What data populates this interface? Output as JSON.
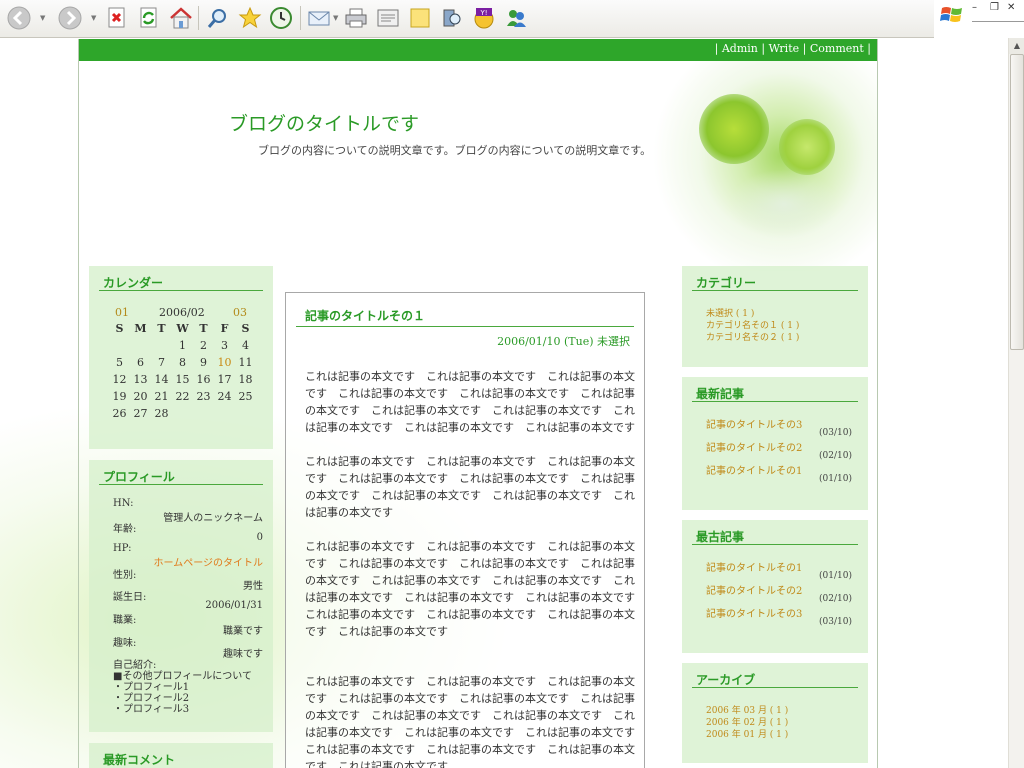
{
  "browser": {
    "toolbar_icons": [
      "back-icon",
      "forward-icon",
      "stop-icon",
      "refresh-icon",
      "home-icon",
      "search-icon",
      "favorites-icon",
      "history-icon",
      "mail-icon",
      "print-icon",
      "edit-icon",
      "discuss-icon",
      "research-icon",
      "messenger-yahoo-icon",
      "messenger-icon"
    ]
  },
  "window": {
    "minimize_glyph": "–",
    "restore_glyph": "❐",
    "close_glyph": "✕"
  },
  "topbar": {
    "sep": "|",
    "links": [
      "Admin",
      "Write",
      "Comment"
    ]
  },
  "header": {
    "title": "ブログのタイトルです",
    "description": "ブログの内容についての説明文章です。ブログの内容についての説明文章です。"
  },
  "calendar": {
    "title": "カレンダー",
    "prev": "01",
    "month": "2006/02",
    "next": "03",
    "weekdays": [
      "S",
      "M",
      "T",
      "W",
      "T",
      "F",
      "S"
    ],
    "weeks": [
      [
        "",
        "",
        "",
        "1",
        "2",
        "3",
        "4"
      ],
      [
        "5",
        "6",
        "7",
        "8",
        "9",
        "10",
        "11"
      ],
      [
        "12",
        "13",
        "14",
        "15",
        "16",
        "17",
        "18"
      ],
      [
        "19",
        "20",
        "21",
        "22",
        "23",
        "24",
        "25"
      ],
      [
        "26",
        "27",
        "28",
        "",
        "",
        "",
        ""
      ]
    ],
    "highlight": "10"
  },
  "profile": {
    "title": "プロフィール",
    "rows": [
      {
        "label": "HN:",
        "value": ""
      },
      {
        "label": "",
        "value": "管理人のニックネーム"
      },
      {
        "label": "年齢:",
        "value": ""
      },
      {
        "label": "",
        "value": "0"
      },
      {
        "label": "HP:",
        "value": ""
      },
      {
        "label": "",
        "value": "ホームページのタイトル"
      },
      {
        "label": "性別:",
        "value": ""
      },
      {
        "label": "",
        "value": "男性"
      },
      {
        "label": "誕生日:",
        "value": ""
      },
      {
        "label": "",
        "value": "2006/01/31"
      },
      {
        "label": "職業:",
        "value": ""
      },
      {
        "label": "",
        "value": "職業です"
      },
      {
        "label": "趣味:",
        "value": ""
      },
      {
        "label": "",
        "value": "趣味です"
      }
    ],
    "intro_label": "自己紹介:",
    "intro_lines": [
      "■その他プロフィールについて",
      "・プロフィール1",
      "・プロフィール2",
      "・プロフィール3"
    ]
  },
  "recent_comments": {
    "title": "最新コメント"
  },
  "categories": {
    "title": "カテゴリー",
    "items": [
      "未選択 ( 1 )",
      "カテゴリ名その１ ( 1 )",
      "カテゴリ名その２ ( 1 )"
    ]
  },
  "latest_entries": {
    "title": "最新記事",
    "items": [
      {
        "title": "記事のタイトルその3",
        "date": "(03/10)"
      },
      {
        "title": "記事のタイトルその2",
        "date": "(02/10)"
      },
      {
        "title": "記事のタイトルその1",
        "date": "(01/10)"
      }
    ]
  },
  "oldest_entries": {
    "title": "最古記事",
    "items": [
      {
        "title": "記事のタイトルその1",
        "date": "(01/10)"
      },
      {
        "title": "記事のタイトルその2",
        "date": "(02/10)"
      },
      {
        "title": "記事のタイトルその3",
        "date": "(03/10)"
      }
    ]
  },
  "archive": {
    "title": "アーカイブ",
    "items": [
      "2006 年 03 月 ( 1 )",
      "2006 年 02 月 ( 1 )",
      "2006 年 01 月 ( 1 )"
    ]
  },
  "article": {
    "title": "記事のタイトルその１",
    "date": "2006/01/10 (Tue)",
    "category": "未選択",
    "paragraphs": [
      [
        "これは記事の本文です　これは記事の本文です　これは記事の本文",
        "です　これは記事の本文です　これは記事の本文です　これは記事",
        "の本文です　これは記事の本文です　これは記事の本文です　これ",
        "は記事の本文です　これは記事の本文です　これは記事の本文です"
      ],
      [
        "これは記事の本文です　これは記事の本文です　これは記事の本文",
        "です　これは記事の本文です　これは記事の本文です　これは記事",
        "の本文です　これは記事の本文です　これは記事の本文です　これ",
        "は記事の本文です"
      ],
      [
        "これは記事の本文です　これは記事の本文です　これは記事の本文",
        "です　これは記事の本文です　これは記事の本文です　これは記事",
        "の本文です　これは記事の本文です　これは記事の本文です　これ",
        "は記事の本文です　これは記事の本文です　これは記事の本文です",
        "これは記事の本文です　これは記事の本文です　これは記事の本文",
        "です　これは記事の本文です"
      ],
      [
        "これは記事の本文です　これは記事の本文です　これは記事の本文",
        "です　これは記事の本文です　これは記事の本文です　これは記事",
        "の本文です　これは記事の本文です　これは記事の本文です　これ",
        "は記事の本文です　これは記事の本文です　これは記事の本文です",
        "これは記事の本文です　これは記事の本文です　これは記事の本文",
        "です　これは記事の本文です"
      ]
    ]
  },
  "colors": {
    "accent_green": "#2ea62a",
    "title_green": "#2a9a26",
    "link_gold": "#c08a19",
    "sidebar_bg": "#d6f0cc"
  }
}
